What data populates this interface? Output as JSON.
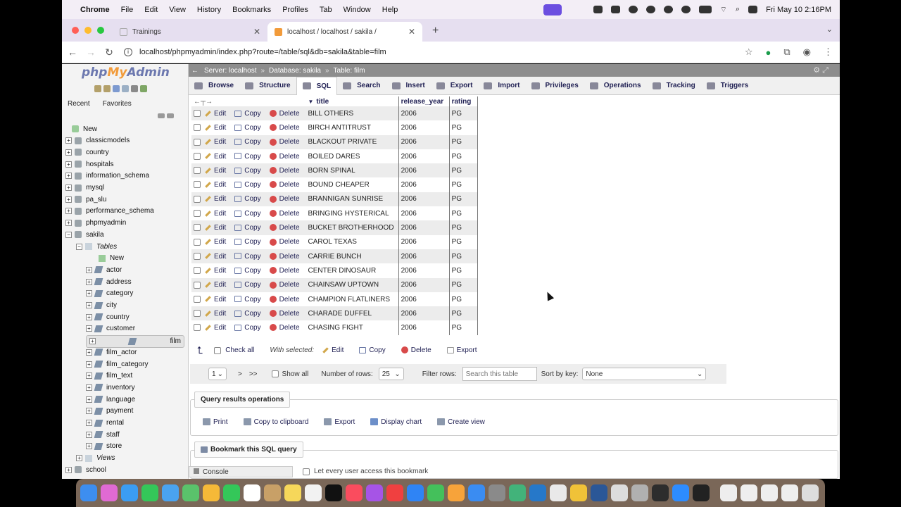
{
  "menubar": {
    "app": "Chrome",
    "items": [
      "File",
      "Edit",
      "View",
      "History",
      "Bookmarks",
      "Profiles",
      "Tab",
      "Window",
      "Help"
    ],
    "clock": "Fri May 10  2:16PM"
  },
  "browser": {
    "tabs": [
      {
        "title": "Trainings",
        "active": false
      },
      {
        "title": "localhost / localhost / sakila /",
        "active": true
      }
    ],
    "url": "localhost/phpmyadmin/index.php?route=/table/sql&db=sakila&table=film"
  },
  "pma": {
    "logo_php": "php",
    "logo_my": "My",
    "logo_admin": "Admin",
    "recent": "Recent",
    "favorites": "Favorites",
    "tree": {
      "new": "New",
      "databases": [
        "classicmodels",
        "country",
        "hospitals",
        "information_schema",
        "mysql",
        "pa_slu",
        "performance_schema",
        "phpmyadmin",
        "sakila"
      ],
      "tables_label": "Tables",
      "table_new": "New",
      "tables": [
        "actor",
        "address",
        "category",
        "city",
        "country",
        "customer",
        "film",
        "film_actor",
        "film_category",
        "film_text",
        "inventory",
        "language",
        "payment",
        "rental",
        "staff",
        "store"
      ],
      "views": "Views",
      "school": "school"
    },
    "breadcrumb": {
      "server": "Server: localhost",
      "database": "Database: sakila",
      "table": "Table: film"
    },
    "topmenu": [
      "Browse",
      "Structure",
      "SQL",
      "Search",
      "Insert",
      "Export",
      "Import",
      "Privileges",
      "Operations",
      "Tracking",
      "Triggers"
    ],
    "active_tab": "SQL",
    "columns": [
      "title",
      "release_year",
      "rating"
    ],
    "row_actions": {
      "edit": "Edit",
      "copy": "Copy",
      "delete": "Delete"
    },
    "rows": [
      {
        "title": "BILL OTHERS",
        "year": "2006",
        "rating": "PG"
      },
      {
        "title": "BIRCH ANTITRUST",
        "year": "2006",
        "rating": "PG"
      },
      {
        "title": "BLACKOUT PRIVATE",
        "year": "2006",
        "rating": "PG"
      },
      {
        "title": "BOILED DARES",
        "year": "2006",
        "rating": "PG"
      },
      {
        "title": "BORN SPINAL",
        "year": "2006",
        "rating": "PG"
      },
      {
        "title": "BOUND CHEAPER",
        "year": "2006",
        "rating": "PG"
      },
      {
        "title": "BRANNIGAN SUNRISE",
        "year": "2006",
        "rating": "PG"
      },
      {
        "title": "BRINGING HYSTERICAL",
        "year": "2006",
        "rating": "PG"
      },
      {
        "title": "BUCKET BROTHERHOOD",
        "year": "2006",
        "rating": "PG"
      },
      {
        "title": "CAROL TEXAS",
        "year": "2006",
        "rating": "PG"
      },
      {
        "title": "CARRIE BUNCH",
        "year": "2006",
        "rating": "PG"
      },
      {
        "title": "CENTER DINOSAUR",
        "year": "2006",
        "rating": "PG"
      },
      {
        "title": "CHAINSAW UPTOWN",
        "year": "2006",
        "rating": "PG"
      },
      {
        "title": "CHAMPION FLATLINERS",
        "year": "2006",
        "rating": "PG"
      },
      {
        "title": "CHARADE DUFFEL",
        "year": "2006",
        "rating": "PG"
      },
      {
        "title": "CHASING FIGHT",
        "year": "2006",
        "rating": "PG"
      }
    ],
    "with_selected": {
      "check_all": "Check all",
      "label": "With selected:",
      "edit": "Edit",
      "copy": "Copy",
      "delete": "Delete",
      "export": "Export"
    },
    "pager": {
      "page": "1",
      "next": ">",
      "last": ">>",
      "show_all": "Show all",
      "num_rows_label": "Number of rows:",
      "num_rows": "25",
      "filter_label": "Filter rows:",
      "filter_placeholder": "Search this table",
      "sort_label": "Sort by key:",
      "sort_value": "None"
    },
    "query_ops": {
      "title": "Query results operations",
      "links": [
        "Print",
        "Copy to clipboard",
        "Export",
        "Display chart",
        "Create view"
      ]
    },
    "bookmark": {
      "title": "Bookmark this SQL query",
      "let_every": "Let every user access this bookmark"
    },
    "console": "Console"
  },
  "colors": {
    "pma_blue": "#6c78af",
    "pma_orange": "#f29b3a",
    "menubar_bg": "#f3eef6",
    "tabbar_bg": "#e6dff0"
  }
}
